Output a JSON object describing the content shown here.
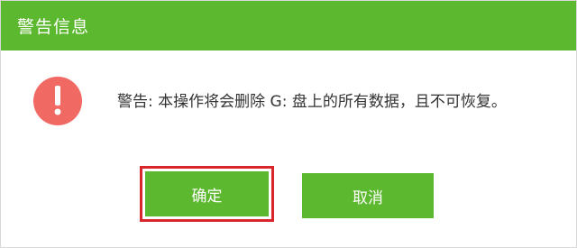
{
  "dialog": {
    "title": "警告信息",
    "message": "警告: 本操作将会删除 G: 盘上的所有数据，且不可恢复。",
    "icon": "exclamation-icon",
    "buttons": {
      "confirm_label": "确定",
      "cancel_label": "取消"
    }
  },
  "colors": {
    "title_bar": "#5cb82e",
    "button": "#5cb82e",
    "warning_icon": "#f06a63",
    "highlight_border": "#d9262d"
  }
}
